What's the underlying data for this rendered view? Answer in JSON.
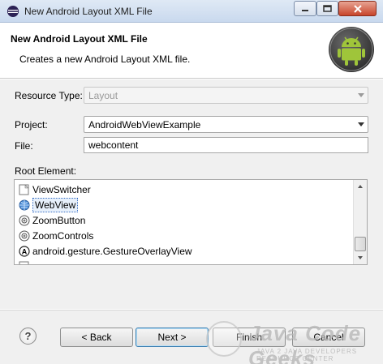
{
  "window": {
    "title": "New Android Layout XML File",
    "controls": {
      "minimize": "minimize-icon",
      "maximize": "maximize-icon",
      "close": "close-icon"
    }
  },
  "header": {
    "title": "New Android Layout XML File",
    "description": "Creates a new Android Layout XML file.",
    "logo": "android-icon"
  },
  "form": {
    "resource_type": {
      "label": "Resource Type:",
      "value": "Layout",
      "enabled": false
    },
    "project": {
      "label": "Project:",
      "value": "AndroidWebViewExample"
    },
    "file": {
      "label": "File:",
      "value": "webcontent"
    },
    "root_element": {
      "label": "Root Element:",
      "items": [
        {
          "label": "ViewSwitcher",
          "icon": "view-icon",
          "selected": false
        },
        {
          "label": "WebView",
          "icon": "globe-icon",
          "selected": true
        },
        {
          "label": "ZoomButton",
          "icon": "zoom-icon",
          "selected": false
        },
        {
          "label": "ZoomControls",
          "icon": "zoom-icon",
          "selected": false
        },
        {
          "label": "android.gesture.GestureOverlayView",
          "icon": "gesture-icon",
          "selected": false
        }
      ]
    }
  },
  "footer": {
    "help": "?",
    "back": "< Back",
    "next": "Next >",
    "finish": "Finish",
    "cancel": "Cancel"
  },
  "watermark": {
    "title": "Java Code Geeks",
    "subtitle": "JAVA 2 JAVA DEVELOPERS RESOURCE CENTER"
  },
  "colors": {
    "titlebar": "#c9d9ee",
    "dialog_bg": "#f0f0f0",
    "selection": "#3a6fc4",
    "android_green": "#9fc53a"
  }
}
